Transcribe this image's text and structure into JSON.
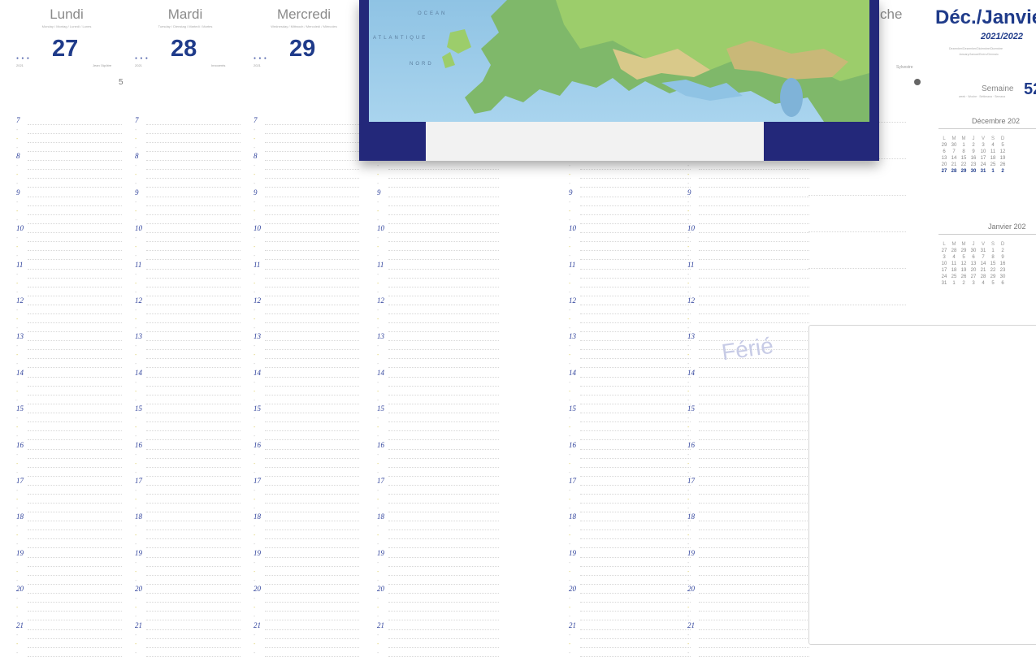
{
  "days": [
    {
      "name": "Lundi",
      "translations": "Monday / Montag / Lunedì / Lunes",
      "number": "27",
      "year": "2021",
      "saint": "Jean l'Apôtre",
      "extra": "5"
    },
    {
      "name": "Mardi",
      "translations": "Tuesday / Dienstag / Martedì / Martes",
      "number": "28",
      "year": "2021",
      "saint": "Innocents",
      "extra": ""
    },
    {
      "name": "Mercredi",
      "translations": "Wednesday / Mittwoch / Mercoledì / Miércoles",
      "number": "29",
      "year": "2021",
      "saint": "",
      "extra": ""
    }
  ],
  "sunday_name_fragment": "che",
  "sunday_saint": "Sylvestre",
  "hours": [
    "7",
    "8",
    "9",
    "10",
    "11",
    "12",
    "13",
    "14",
    "15",
    "16",
    "17",
    "18",
    "19",
    "20",
    "21"
  ],
  "map": {
    "labels": [
      "OCEAN",
      "ATLANTIQUE",
      "NORD"
    ]
  },
  "ferie_label": "Férié",
  "right_panel": {
    "title": "Déc./Janvie",
    "year": "2021/2022",
    "subtitle_line1": "Dezember/Dezember/Diciembre/Dicembre",
    "subtitle_line2": "January/Januar/Enero/Gennaio",
    "week_label": "Semaine",
    "week_label_sub": "week · Woche · Settimana · Semana",
    "week_number": "52",
    "cal1": {
      "title": "Décembre 202",
      "headers": [
        "L",
        "M",
        "M",
        "J",
        "V",
        "S",
        "D"
      ],
      "rows": [
        [
          "29",
          "30",
          "1",
          "2",
          "3",
          "4",
          "5"
        ],
        [
          "6",
          "7",
          "8",
          "9",
          "10",
          "11",
          "12"
        ],
        [
          "13",
          "14",
          "15",
          "16",
          "17",
          "18",
          "19"
        ],
        [
          "20",
          "21",
          "22",
          "23",
          "24",
          "25",
          "26"
        ],
        [
          "27",
          "28",
          "29",
          "30",
          "31",
          "1",
          "2"
        ]
      ]
    },
    "cal2": {
      "title": "Janvier 202",
      "headers": [
        "L",
        "M",
        "M",
        "J",
        "V",
        "S",
        "D"
      ],
      "rows": [
        [
          "27",
          "28",
          "29",
          "30",
          "31",
          "1",
          "2"
        ],
        [
          "3",
          "4",
          "5",
          "6",
          "7",
          "8",
          "9"
        ],
        [
          "10",
          "11",
          "12",
          "13",
          "14",
          "15",
          "16"
        ],
        [
          "17",
          "18",
          "19",
          "20",
          "21",
          "22",
          "23"
        ],
        [
          "24",
          "25",
          "26",
          "27",
          "28",
          "29",
          "30"
        ],
        [
          "31",
          "1",
          "2",
          "3",
          "4",
          "5",
          "6"
        ]
      ]
    }
  },
  "colors": {
    "accent": "#1f3b8a",
    "map_frame": "#23287a",
    "hour_text": "#2c3f9a"
  }
}
